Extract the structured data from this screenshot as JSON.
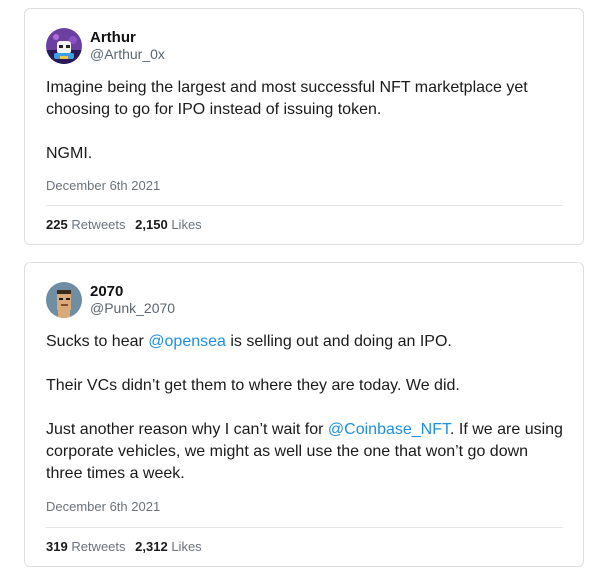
{
  "tweets": [
    {
      "author": {
        "name": "Arthur",
        "handle": "@Arthur_0x"
      },
      "paragraphs": [
        "Imagine being the largest and most successful NFT marketplace yet choosing to go for IPO instead of issuing token.",
        "NGMI."
      ],
      "date": "December 6th 2021",
      "retweets_count": "225",
      "retweets_label": "Retweets",
      "likes_count": "2,150",
      "likes_label": "Likes"
    },
    {
      "author": {
        "name": "2070",
        "handle": "@Punk_2070"
      },
      "p1": {
        "before": "Sucks to hear ",
        "mention": "@opensea",
        "after": " is selling out and doing an IPO."
      },
      "p2": "Their VCs didn’t get them to where they are today. We did.",
      "p3": {
        "before": "Just another reason why I can’t wait for ",
        "mention": "@Coinbase_NFT",
        "after": ". If we are using corporate vehicles, we might as well use the one that won’t go down three times a week."
      },
      "date": "December 6th 2021",
      "retweets_count": "319",
      "retweets_label": "Retweets",
      "likes_count": "2,312",
      "likes_label": "Likes"
    }
  ]
}
